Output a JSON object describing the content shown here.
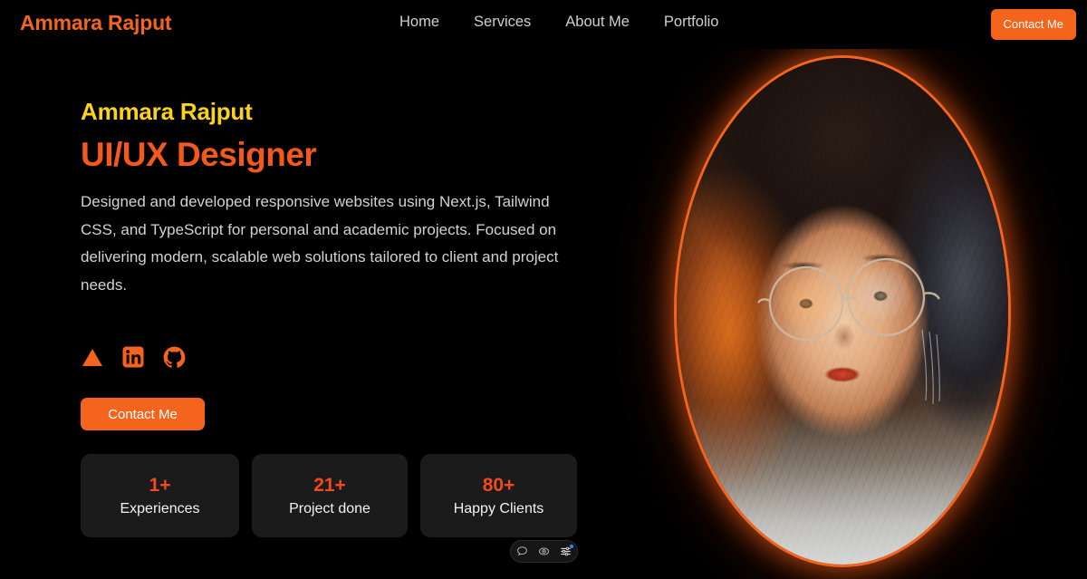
{
  "site": {
    "background_color": "#000000",
    "accent_orange": "#f4641c",
    "accent_yellow": "#fbd417",
    "accent_red_orange": "#f4581b"
  },
  "header": {
    "logo": "Ammara Rajput",
    "nav_items": [
      {
        "label": "Home"
      },
      {
        "label": "Services"
      },
      {
        "label": "About Me"
      },
      {
        "label": "Portfolio"
      }
    ],
    "contact_button_label": "Contact Me"
  },
  "hero": {
    "name": "Ammara Rajput",
    "role": "UI/UX Designer",
    "description": "Designed and developed responsive websites using Next.js, Tailwind CSS, and TypeScript for personal and academic projects. Focused on delivering modern, scalable web solutions tailored to client and project needs.",
    "contact_button_label": "Contact Me",
    "social_icons": [
      {
        "name": "vercel-triangle-icon"
      },
      {
        "name": "linkedin-icon"
      },
      {
        "name": "github-icon"
      }
    ],
    "stats": [
      {
        "value": "1+",
        "label": "Experiences"
      },
      {
        "value": "21+",
        "label": "Project done"
      },
      {
        "value": "80+",
        "label": "Happy Clients"
      }
    ],
    "portrait_alt": "Illustrated portrait of a woman with curly hair and round glasses in an oval orange-glowing frame"
  },
  "floating_widget": {
    "icons": [
      {
        "name": "chat-bubble-icon"
      },
      {
        "name": "eye-target-icon"
      },
      {
        "name": "sliders-icon",
        "has_badge": true
      }
    ],
    "badge_color": "#3b82f6"
  }
}
